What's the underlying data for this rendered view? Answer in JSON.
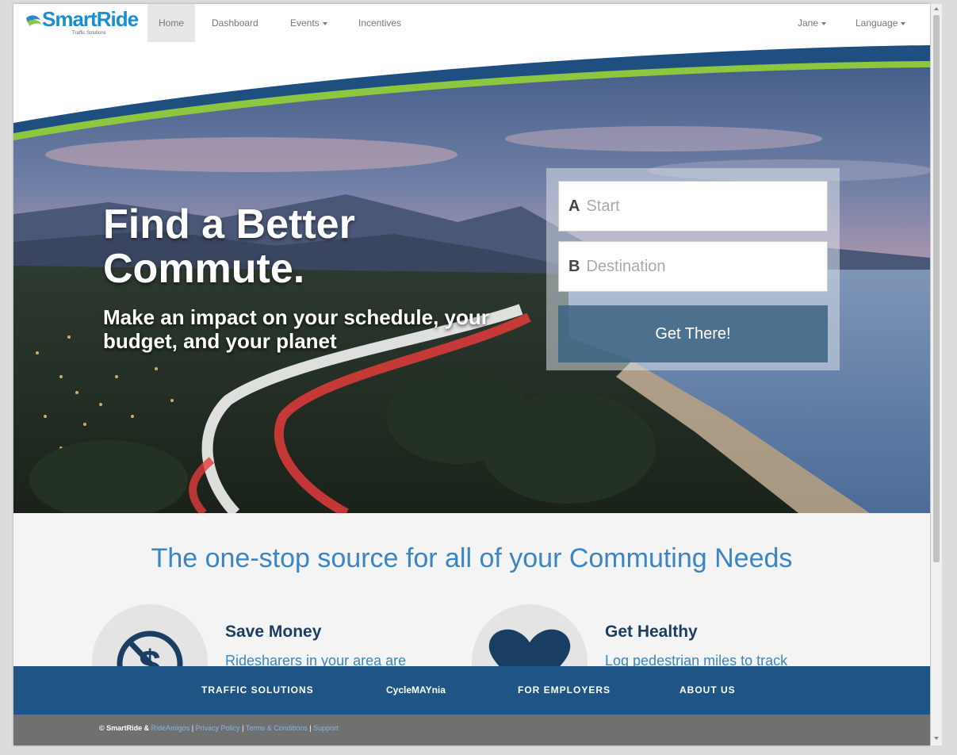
{
  "brand": {
    "name": "SmartRide",
    "tagline": "Traffic Solutions"
  },
  "nav": {
    "items": [
      {
        "label": "Home",
        "active": true
      },
      {
        "label": "Dashboard"
      },
      {
        "label": "Events",
        "dropdown": true
      },
      {
        "label": "Incentives"
      }
    ],
    "user": "Jane",
    "language": "Language"
  },
  "hero": {
    "title": "Find a Better Commute.",
    "subtitle": "Make an impact on your schedule, your budget, and your planet",
    "start_letter": "A",
    "start_placeholder": "Start",
    "dest_letter": "B",
    "dest_placeholder": "Destination",
    "button": "Get There!"
  },
  "main": {
    "tagline": "The one-stop source for all of your Commuting Needs",
    "features": [
      {
        "title": "Save Money",
        "text": "Ridesharers in your area are",
        "icon": "no-money-icon"
      },
      {
        "title": "Get Healthy",
        "text": "Log pedestrian miles to track",
        "icon": "heart-icon"
      }
    ]
  },
  "footer": {
    "links": [
      "TRAFFIC SOLUTIONS",
      "CycleMAYnia",
      "FOR EMPLOYERS",
      "ABOUT US"
    ],
    "copyright": "© SmartRide &",
    "legal_links": [
      "RideAmigos",
      "Privacy Policy",
      "Terms & Conditions",
      "Support"
    ]
  },
  "colors": {
    "accent": "#3a85c3",
    "navy": "#1e5585",
    "green": "#8dc63f"
  }
}
